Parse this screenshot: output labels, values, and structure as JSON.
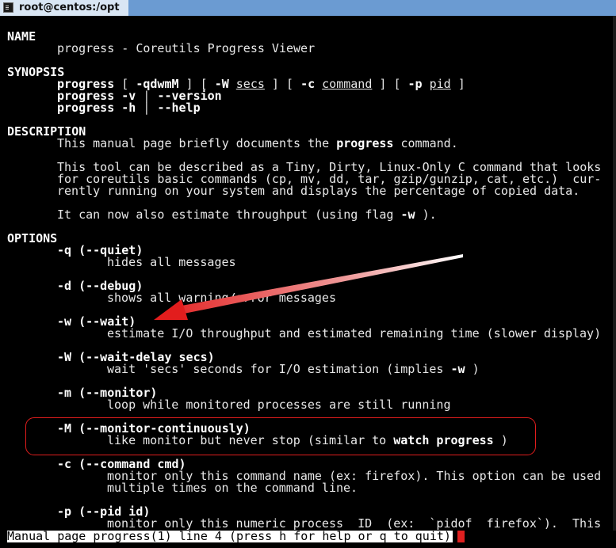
{
  "window": {
    "title": "root@centos:/opt",
    "terminal_icon": "terminal-icon"
  },
  "man": {
    "name_heading": "NAME",
    "name_text": "progress - Coreutils Progress Viewer",
    "synopsis_heading": "SYNOPSIS",
    "syn1": {
      "cmd": "progress",
      "t1": " [ ",
      "opt1": "-qdwmM",
      "t2": " ] [ ",
      "opt2": "-W",
      "t3": " ",
      "arg2": "secs",
      "t4": " ] [ ",
      "opt3": "-c",
      "t5": " ",
      "arg3": "command",
      "t6": " ] [ ",
      "opt4": "-p",
      "t7": " ",
      "arg4": "pid",
      "t8": " ]"
    },
    "syn2": {
      "cmd": "progress",
      "t1": " ",
      "opt1": "-v",
      "t2": " | ",
      "opt2": "--version"
    },
    "syn3": {
      "cmd": "progress",
      "t1": " ",
      "opt1": "-h",
      "t2": " | ",
      "opt2": "--help"
    },
    "description_heading": "DESCRIPTION",
    "desc1": {
      "pre": "This manual page briefly documents the ",
      "cmd": "progress",
      "post": " command."
    },
    "desc2": [
      "This tool can be described as a Tiny, Dirty, Linux-Only C command that looks",
      "for coreutils basic commands (cp, mv, dd, tar, gzip/gunzip, cat, etc.)  cur-",
      "rently running on your system and displays the percentage of copied data."
    ],
    "desc3": {
      "pre": "It can now also estimate throughput (using flag ",
      "flag": "-w",
      "post": " )."
    },
    "options_heading": "OPTIONS",
    "options": [
      {
        "flag": "-q (--quiet)",
        "desc": "hides all messages"
      },
      {
        "flag": "-d (--debug)",
        "desc": "shows all warning/error messages"
      },
      {
        "flag": "-w (--wait)",
        "desc": "estimate I/O throughput and estimated remaining time (slower display)"
      },
      {
        "flag": "-W (--wait-delay secs)",
        "desc_pre": "wait 'secs' seconds for I/O estimation (implies ",
        "desc_flag": "-w",
        "desc_post": " )"
      },
      {
        "flag": "-m (--monitor)",
        "desc": "loop while monitored processes are still running"
      },
      {
        "flag": "-M (--monitor-continuously)",
        "desc_pre": "like monitor but never stop (similar to ",
        "desc_b1": "watch",
        "desc_mid": " ",
        "desc_b2": "progress",
        "desc_post": " )"
      },
      {
        "flag": "-c (--command cmd)",
        "desc1": "monitor only this command name (ex: firefox). This option can be used",
        "desc2": "multiple times on the command line."
      },
      {
        "flag": "-p (--pid id)",
        "desc": "monitor only this numeric process  ID  (ex:  `pidof  firefox`).  This"
      }
    ]
  },
  "status_line": "Manual page progress(1) line 4 (press h for help or q to quit)",
  "annotation": {
    "arrow_color": "#e21d1d",
    "highlight_color": "#e21d1d"
  }
}
